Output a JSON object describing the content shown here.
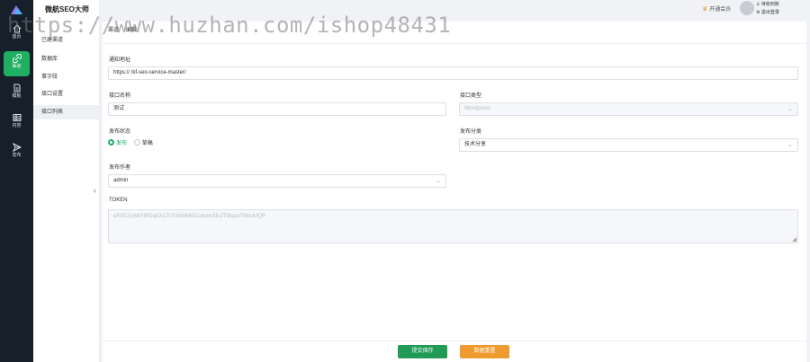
{
  "app": {
    "title": "微航SEO大师"
  },
  "watermark": "https://www.huzhan.com/ishop48431",
  "rail": {
    "items": [
      {
        "label": "首页",
        "icon": "home-icon"
      },
      {
        "label": "渠道",
        "icon": "link-icon"
      },
      {
        "label": "模板",
        "icon": "document-icon"
      },
      {
        "label": "内容",
        "icon": "grid-icon"
      },
      {
        "label": "发布",
        "icon": "send-icon"
      }
    ]
  },
  "submenu": {
    "items": [
      {
        "label": "已建渠道"
      },
      {
        "label": "数据库"
      },
      {
        "label": "事字段"
      },
      {
        "label": "接口设置"
      },
      {
        "label": "接口列表"
      }
    ]
  },
  "header": {
    "vip_label": "开通会员",
    "user_links": [
      "待收到账",
      "退出登录"
    ]
  },
  "panel": {
    "tabs": [
      "渠道",
      "编辑"
    ]
  },
  "form": {
    "notify_url_label": "通知地址",
    "notify_url_value": "https://                /kf-seo-service-master/",
    "api_name_label": "接口名称",
    "api_name_value": "测试",
    "api_type_label": "接口类型",
    "api_type_value": "Wordpress",
    "publish_status_label": "发布状态",
    "publish_status_options": [
      "发布",
      "草稿"
    ],
    "publish_category_label": "发布分类",
    "publish_category_value": "技术分享",
    "publish_author_label": "发布作者",
    "publish_author_value": "admin",
    "token_label": "TOKEN",
    "token_value": "eRSCGqWYiRDakJcLTsYzkWk8GUukowXfoJTMquxTWeuUQP"
  },
  "footer": {
    "submit_label": "提交保存",
    "reset_label": "数据重置"
  },
  "colors": {
    "accent": "#1fae62",
    "submit": "#1f9b56",
    "reset": "#ee9a2e",
    "rail_bg": "#16202b"
  }
}
